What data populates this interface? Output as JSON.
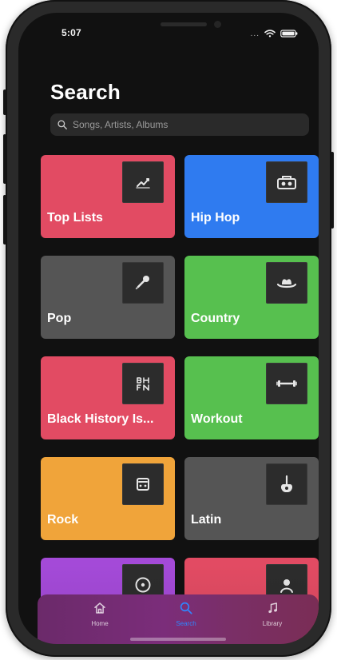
{
  "status_bar": {
    "time": "5:07",
    "signal": "...",
    "icons": [
      "wifi-icon",
      "battery-icon"
    ]
  },
  "page": {
    "title": "Search"
  },
  "search": {
    "placeholder": "Songs, Artists, Albums"
  },
  "categories": [
    {
      "label": "Top Lists",
      "color": "#e24b63",
      "icon": "chart-icon"
    },
    {
      "label": "Hip Hop",
      "color": "#2f7bf0",
      "icon": "boombox-icon"
    },
    {
      "label": "Pop",
      "color": "#555555",
      "icon": "microphone-icon"
    },
    {
      "label": "Country",
      "color": "#57c04f",
      "icon": "cowboy-hat-icon"
    },
    {
      "label": "Black History Is...",
      "color": "#e24b63",
      "icon": "bh-logo-icon"
    },
    {
      "label": "Workout",
      "color": "#57c04f",
      "icon": "dumbbell-icon"
    },
    {
      "label": "Rock",
      "color": "#f0a43a",
      "icon": "amplifier-icon"
    },
    {
      "label": "Latin",
      "color": "#555555",
      "icon": "guitar-icon"
    },
    {
      "label": "",
      "color": "#a44ad8",
      "icon": "vinyl-icon"
    },
    {
      "label": "",
      "color": "#e24b63",
      "icon": "artist-icon"
    }
  ],
  "tabbar": {
    "items": [
      {
        "label": "Home",
        "icon": "home-icon",
        "active": false
      },
      {
        "label": "Search",
        "icon": "search-icon",
        "active": true
      },
      {
        "label": "Library",
        "icon": "music-note-icon",
        "active": false
      }
    ],
    "accent": "#2f86ff"
  }
}
